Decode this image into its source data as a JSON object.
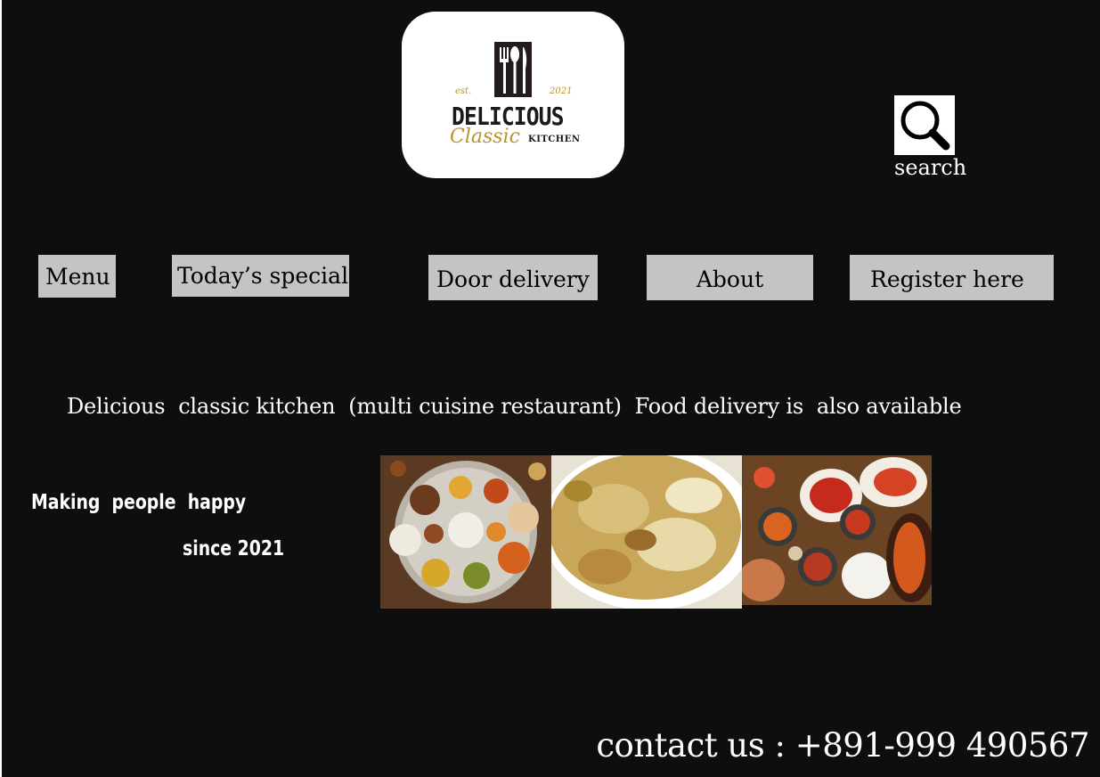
{
  "logo": {
    "est": "est.",
    "year": "2021",
    "name": "DELICIOUS",
    "script": "Classic",
    "kitchen": "KITCHEN"
  },
  "search": {
    "label": "search",
    "icon": "magnifier-icon"
  },
  "nav": {
    "menu": "Menu",
    "special": "Today’s special",
    "delivery": "Door delivery",
    "about": "About",
    "register": "Register here"
  },
  "tagline": "Delicious  classic kitchen  (multi cuisine restaurant)  Food delivery is  also available",
  "motto": {
    "line1": "Making  people  happy",
    "line2": "since 2021"
  },
  "images": [
    {
      "name": "thali-photo"
    },
    {
      "name": "biryani-photo"
    },
    {
      "name": "tandoori-photo"
    }
  ],
  "contact": "contact us : +891-999 490567",
  "colors": {
    "background": "#0e0e0e",
    "nav_button": "#c4c4c4",
    "logo_gold": "#b8942a"
  }
}
